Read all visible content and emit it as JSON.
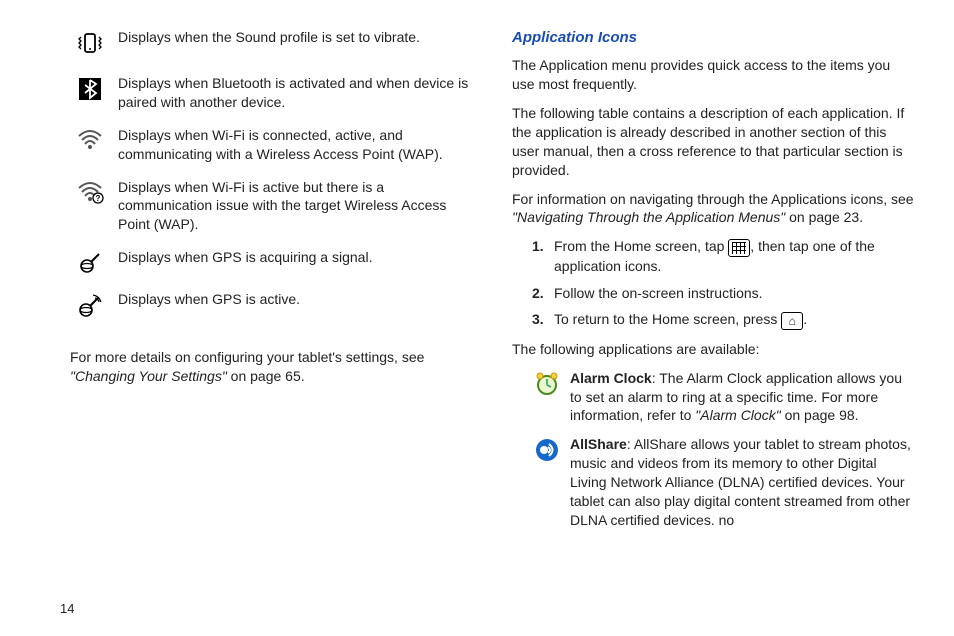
{
  "pageNumber": "14",
  "leftColumn": {
    "iconDescriptions": [
      {
        "iconName": "vibrate-icon",
        "text": "Displays when the Sound profile is set to vibrate."
      },
      {
        "iconName": "bluetooth-icon",
        "text": "Displays when Bluetooth is activated and when device is paired with another device."
      },
      {
        "iconName": "wifi-connected-icon",
        "text": "Displays when Wi-Fi is connected, active, and communicating with a Wireless Access Point (WAP)."
      },
      {
        "iconName": "wifi-issue-icon",
        "text": "Displays when Wi-Fi is active but there is a communication issue with the target Wireless Access Point (WAP)."
      },
      {
        "iconName": "gps-acquiring-icon",
        "text": "Displays when GPS is acquiring a signal."
      },
      {
        "iconName": "gps-active-icon",
        "text": "Displays when GPS is active."
      }
    ],
    "footerNote": {
      "prefix": "For more details on configuring your tablet's settings, see ",
      "linkText": "\"Changing Your Settings\"",
      "suffix": " on page 65."
    }
  },
  "rightColumn": {
    "heading": "Application Icons",
    "intro1": "The Application menu provides quick access to the items you use most frequently.",
    "intro2": "The following table contains a description of each application. If the application is already described in another section of this user manual, then a cross reference to that particular section is provided.",
    "navNote": {
      "prefix": "For information on navigating through the Applications icons, see ",
      "linkText": "\"Navigating Through the Application Menus\"",
      "suffix": " on page 23."
    },
    "steps": [
      {
        "num": "1.",
        "before": "From the Home screen, tap ",
        "after": ", then tap one of the application icons."
      },
      {
        "num": "2.",
        "text": "Follow the on-screen instructions."
      },
      {
        "num": "3.",
        "before": "To return to the Home screen, press ",
        "after": "."
      }
    ],
    "appsAvailableLead": "The following applications are available:",
    "apps": [
      {
        "iconName": "alarm-clock-icon",
        "title": "Alarm Clock",
        "textBefore": ": The Alarm Clock application allows you to set an alarm to ring at a specific time. For more information, refer to ",
        "linkText": "\"Alarm Clock\"",
        "textAfter": "  on page 98."
      },
      {
        "iconName": "allshare-icon",
        "title": "AllShare",
        "textBefore": ": AllShare allows your tablet to stream photos, music and videos from its memory to other Digital Living Network Alliance (DLNA) certified devices. Your tablet can also play digital content streamed from other DLNA certified devices. no",
        "linkText": "",
        "textAfter": ""
      }
    ]
  }
}
